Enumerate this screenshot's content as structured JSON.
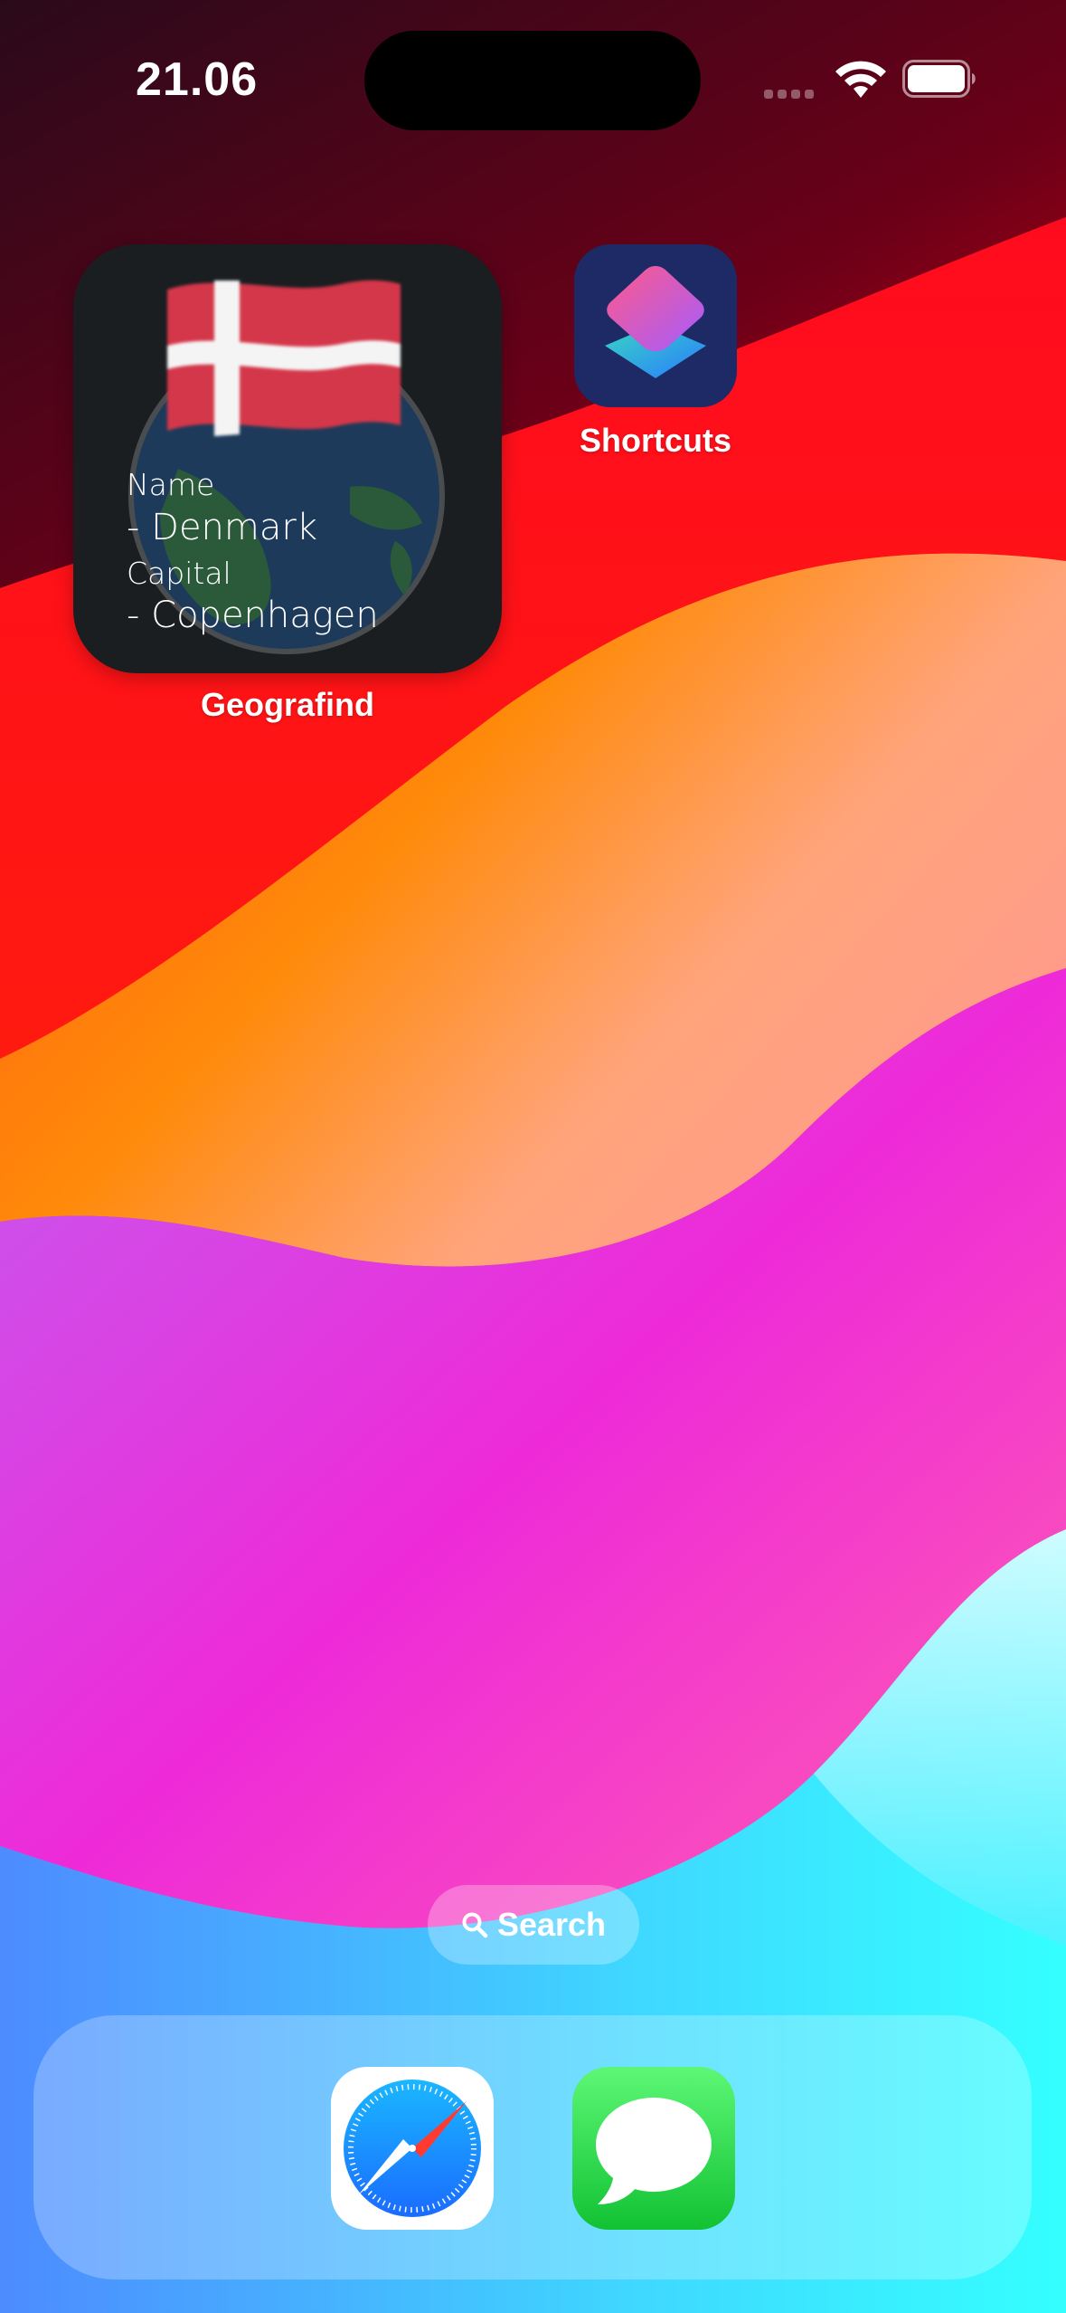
{
  "status_bar": {
    "time": "21.06",
    "signal_icon": "cellular-signal-icon",
    "wifi_icon": "wifi-icon",
    "battery_icon": "battery-icon"
  },
  "widget": {
    "app_name": "Geografind",
    "name_label": "Name",
    "name_value": "- Denmark",
    "capital_label": "Capital",
    "capital_value": "- Copenhagen",
    "flag_icon": "denmark-flag-icon",
    "globe_icon": "globe-icon"
  },
  "home_apps": [
    {
      "label": "Shortcuts",
      "icon": "shortcuts-app-icon"
    }
  ],
  "search": {
    "label": "Search",
    "icon": "search-icon"
  },
  "dock": {
    "apps": [
      {
        "icon": "safari-app-icon"
      },
      {
        "icon": "messages-app-icon"
      }
    ]
  },
  "colors": {
    "widget_bg": "#1a1e21",
    "shortcuts_bg": "#1e2a66",
    "messages_green": "#12c233",
    "safari_blue": "#1a8cff",
    "dk_red": "#d4374a"
  }
}
